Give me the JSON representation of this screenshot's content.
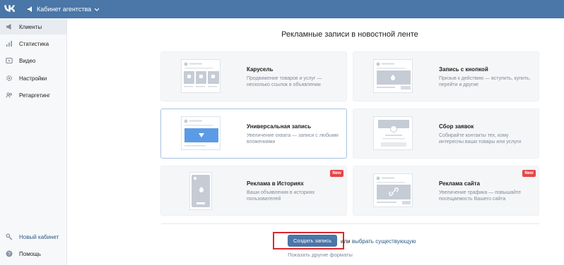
{
  "header": {
    "logo_icon": "vk-logo-icon",
    "agency_label": "Кабинет агентства",
    "color": "#4a76a8"
  },
  "sidebar": {
    "items": [
      {
        "label": "Клиенты",
        "icon": "megaphone-icon",
        "active": true
      },
      {
        "label": "Статистика",
        "icon": "bar-chart-icon"
      },
      {
        "label": "Видео",
        "icon": "video-icon"
      },
      {
        "label": "Настройки",
        "icon": "gear-icon"
      },
      {
        "label": "Ретаргетинг",
        "icon": "audience-icon"
      }
    ],
    "bottom_items": [
      {
        "label": "Новый кабинет",
        "icon": "key-icon"
      },
      {
        "label": "Помощь",
        "icon": "help-icon"
      }
    ]
  },
  "main": {
    "title": "Рекламные записи в новостной ленте",
    "formats": [
      {
        "title": "Карусель",
        "desc": "Продвижение товаров и услуг — несколько ссылок в объявлении"
      },
      {
        "title": "Запись с кнопкой",
        "desc": "Призыв к действию — вступить, купить, перейти и другие"
      },
      {
        "title": "Универсальная запись",
        "desc": "Увеличение охвата — записи с любыми вложениями",
        "selected": true
      },
      {
        "title": "Сбор заявок",
        "desc": "Собирайте контакты тех, кому интересны ваши товары или услуги"
      },
      {
        "title": "Реклама в Историях",
        "desc": "Ваши объявления в историях пользователей",
        "badge": "New"
      },
      {
        "title": "Реклама сайта",
        "desc": "Увеличение трафика — повышайте посещаемость Вашего сайта",
        "badge": "New"
      }
    ],
    "create_button": "Создать запись",
    "or_prefix": "или ",
    "or_link": "выбрать существующую",
    "other_formats": "Показать другие форматы"
  }
}
